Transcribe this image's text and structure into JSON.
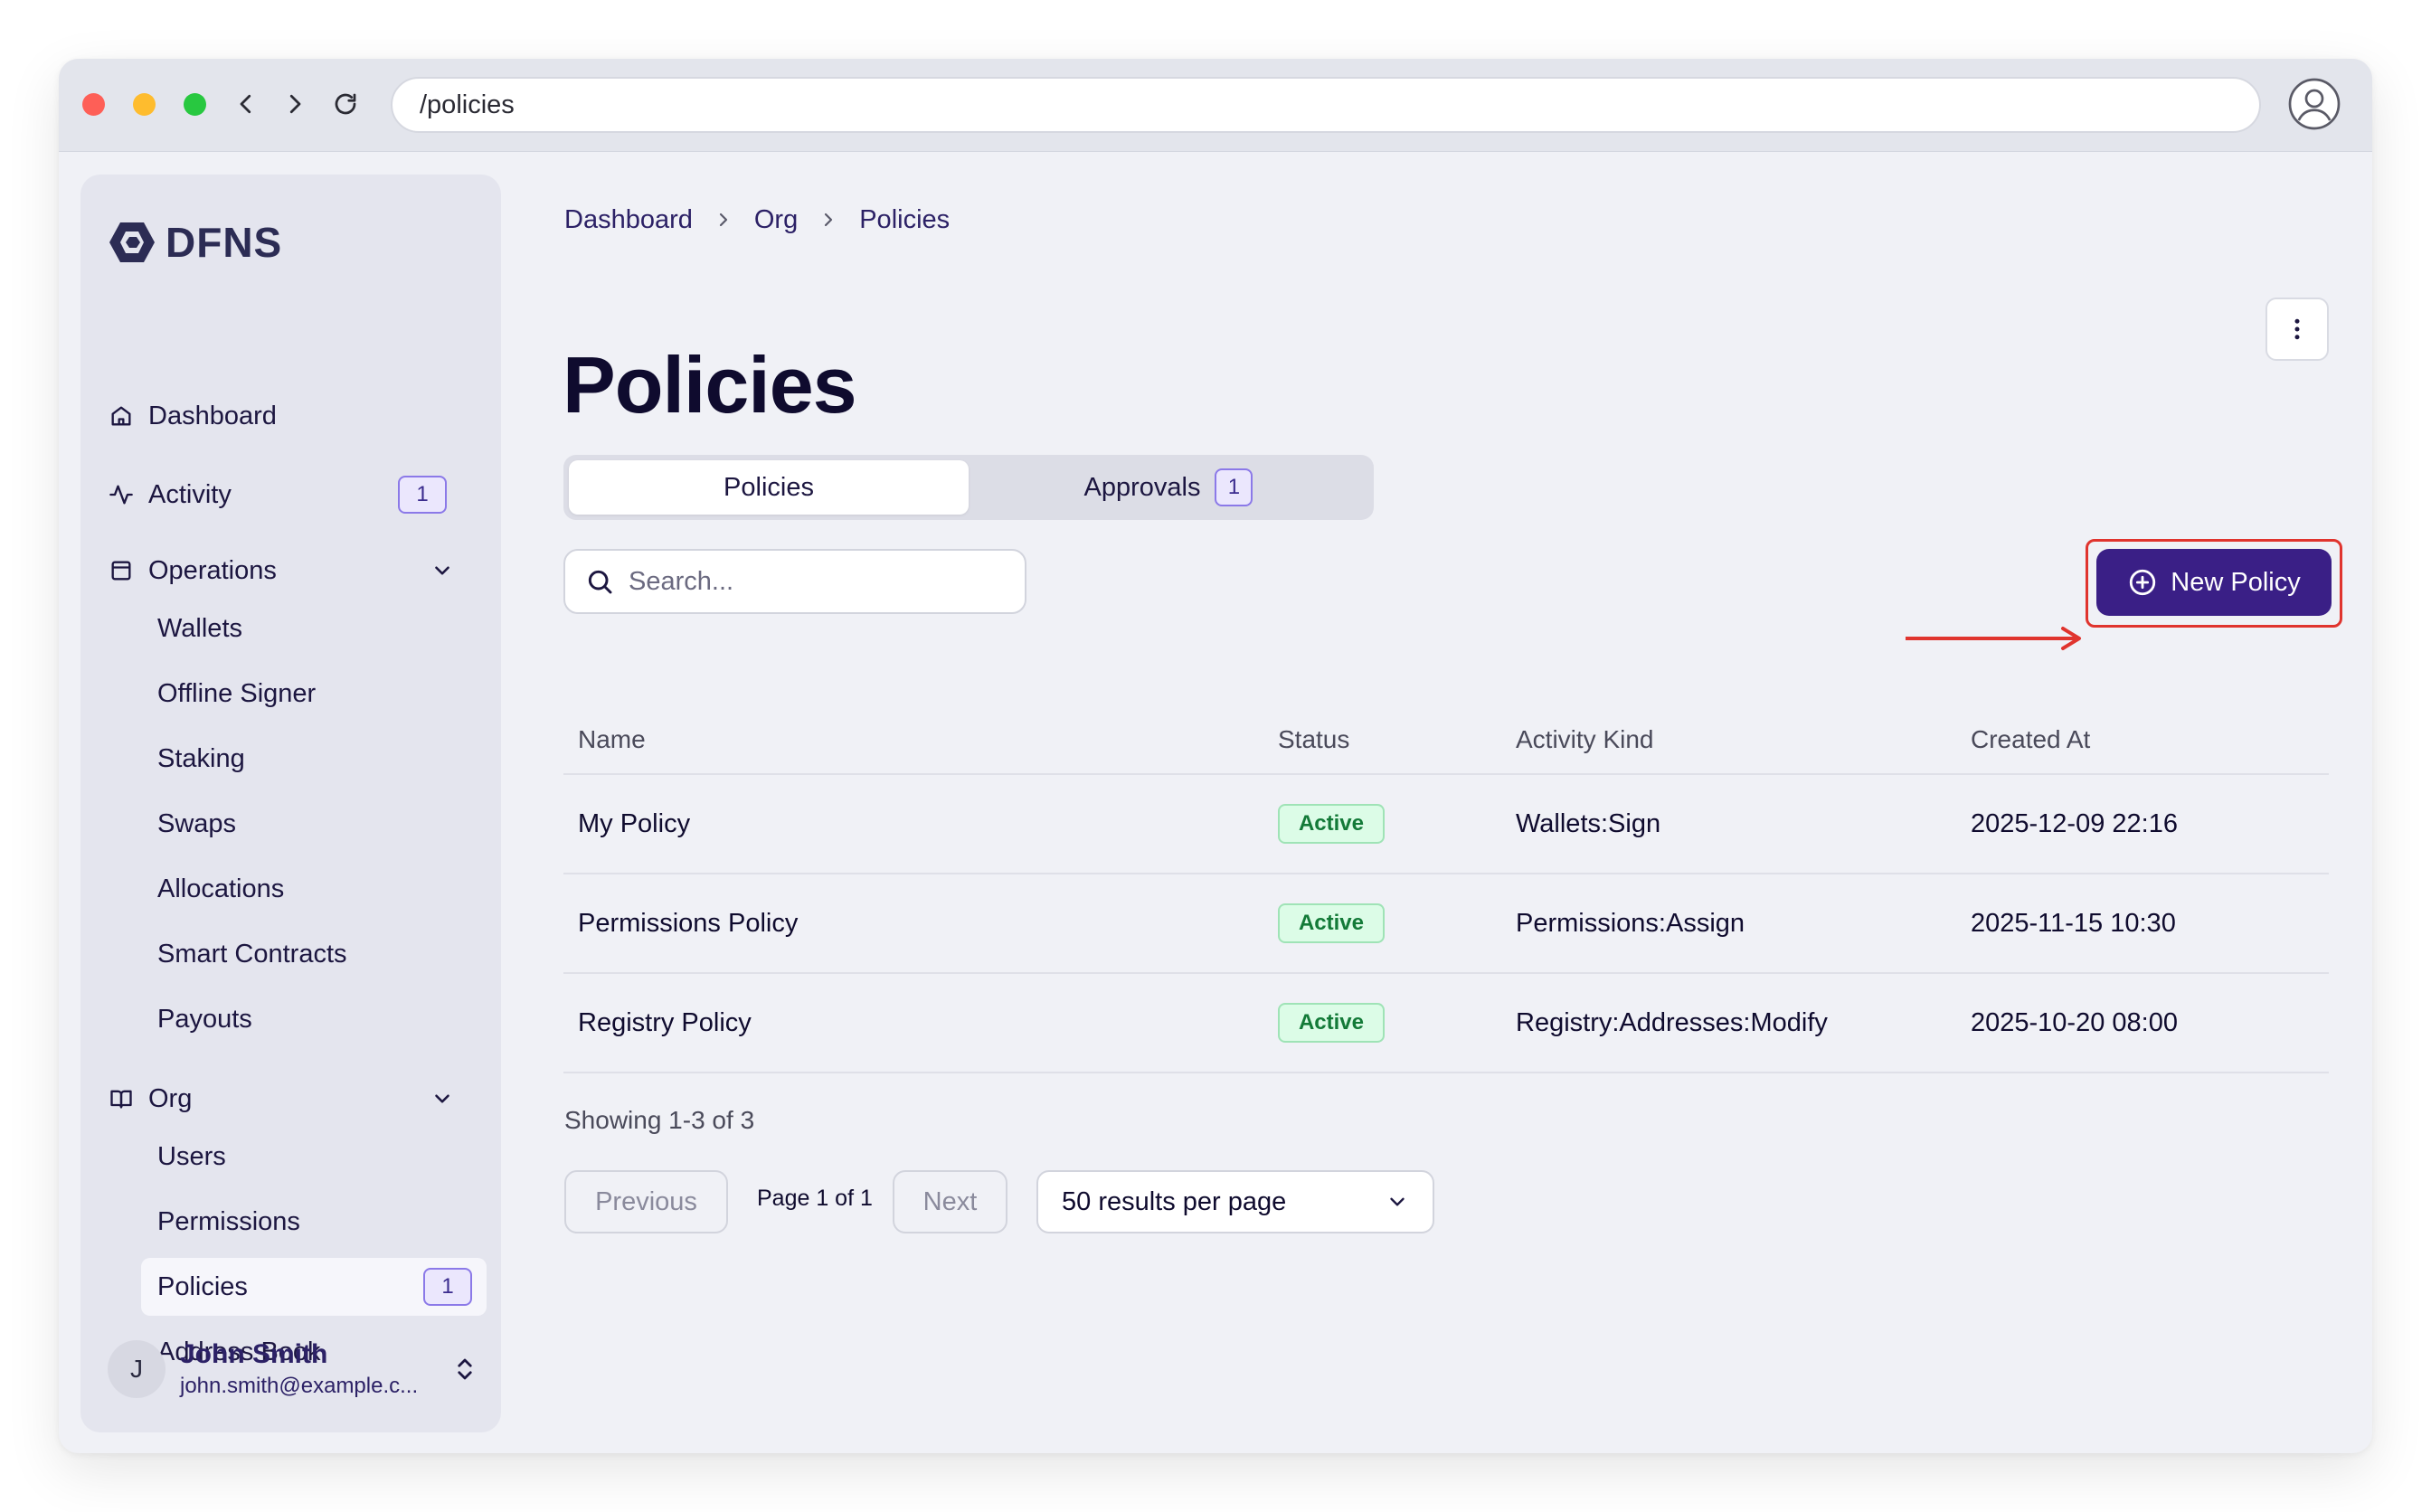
{
  "browser": {
    "url": "/policies"
  },
  "brand": {
    "name": "DFNS"
  },
  "sidebar": {
    "dashboard": "Dashboard",
    "activity": {
      "label": "Activity",
      "badge": "1"
    },
    "operations": {
      "label": "Operations",
      "items": [
        "Wallets",
        "Offline Signer",
        "Staking",
        "Swaps",
        "Allocations",
        "Smart Contracts",
        "Payouts"
      ]
    },
    "org": {
      "label": "Org",
      "users": "Users",
      "permissions": "Permissions",
      "policies": {
        "label": "Policies",
        "badge": "1"
      },
      "address_book": "Address Book"
    },
    "user": {
      "initial": "J",
      "name": "John Smith",
      "email": "john.smith@example.c..."
    }
  },
  "breadcrumb": [
    "Dashboard",
    "Org",
    "Policies"
  ],
  "page": {
    "title": "Policies"
  },
  "tabs": {
    "policies": "Policies",
    "approvals": {
      "label": "Approvals",
      "badge": "1"
    }
  },
  "search": {
    "placeholder": "Search...",
    "value": ""
  },
  "actions": {
    "new_policy": "New Policy"
  },
  "table": {
    "headers": {
      "name": "Name",
      "status": "Status",
      "kind": "Activity Kind",
      "created": "Created At"
    },
    "rows": [
      {
        "name": "My Policy",
        "status": "Active",
        "kind": "Wallets:Sign",
        "created": "2025-12-09 22:16"
      },
      {
        "name": "Permissions Policy",
        "status": "Active",
        "kind": "Permissions:Assign",
        "created": "2025-11-15 10:30"
      },
      {
        "name": "Registry Policy",
        "status": "Active",
        "kind": "Registry:Addresses:Modify",
        "created": "2025-10-20 08:00"
      }
    ]
  },
  "pagination": {
    "showing": "Showing 1-3 of 3",
    "previous": "Previous",
    "page_label": "Page 1 of 1",
    "next": "Next",
    "per_page": "50 results per page"
  },
  "colors": {
    "primary": "#3a1f86",
    "highlight": "#e0342e",
    "status_active": "#137a38",
    "badge_border": "#8b79e8"
  },
  "icons": {
    "browser": [
      "back-icon",
      "forward-icon",
      "reload-icon",
      "profile-icon"
    ],
    "sidebar": [
      "home-icon",
      "activity-icon",
      "operations-icon",
      "org-book-icon",
      "chevron-down-icon"
    ],
    "content": [
      "more-vertical-icon",
      "search-icon",
      "plus-circle-icon",
      "chevron-down-icon"
    ]
  }
}
